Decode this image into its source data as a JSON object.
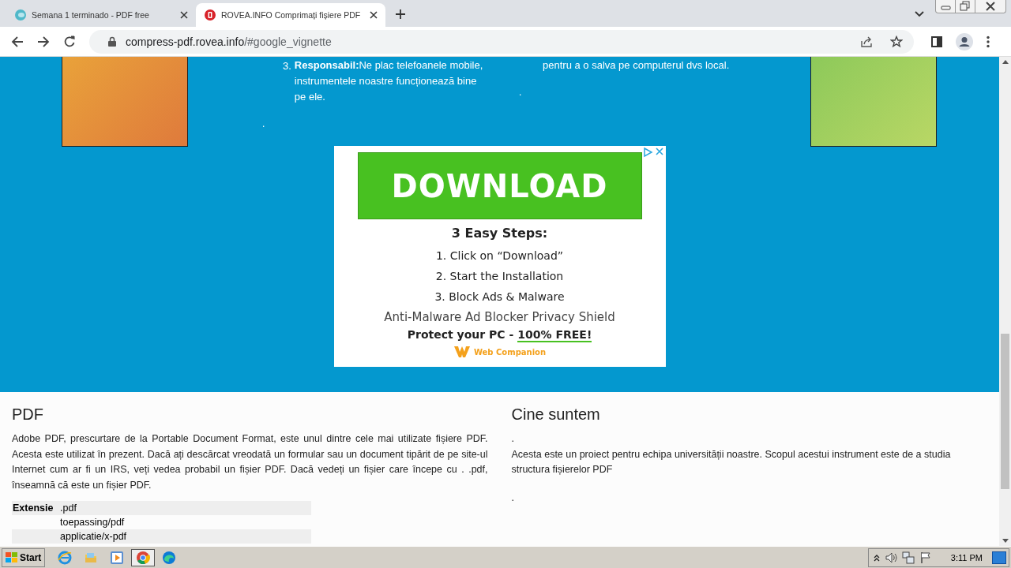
{
  "browser": {
    "tabs": [
      {
        "title": "Semana 1 terminado - PDF free",
        "selected": false
      },
      {
        "title": "ROVEA.INFO Comprimați fișiere PDF",
        "selected": true
      }
    ],
    "url_host": "compress-pdf.rovea.info",
    "url_path": "/#google_vignette"
  },
  "features": {
    "items": [
      {
        "number": "3.",
        "term": "Responsabil:",
        "text": "Ne plac telefoanele mobile, instrumentele noastre funcționează bine pe ele."
      }
    ],
    "dot_left": ".",
    "note": "pentru a o salva pe computerul dvs local.",
    "dot_right": "."
  },
  "ad": {
    "button": "DOWNLOAD",
    "heading": "3 Easy Steps:",
    "steps": [
      "1. Click on “Download”",
      "2. Start the Installation",
      "3. Block Ads & Malware"
    ],
    "tagline": "Anti-Malware Ad Blocker Privacy Shield",
    "offer": "Protect your PC -",
    "offer_highlight": "100% FREE!",
    "brand": "Web Companion"
  },
  "pdf_section": {
    "title": "PDF",
    "text": "Adobe PDF, prescurtare de la Portable Document Format, este unul dintre cele mai utilizate fișiere PDF. Acesta este utilizat în prezent. Dacă ați descărcat vreodată un formular sau un document tipărit de pe site-ul Internet cum ar fi un IRS, veți vedea probabil un fișier PDF. Dacă vedeți un fișier care începe cu . .pdf, înseamnă că este un fișier PDF.",
    "table": [
      {
        "label": "Extensie",
        "value": ".pdf"
      },
      {
        "value": "toepassing/pdf"
      },
      {
        "value": "applicatie/x-pdf"
      }
    ]
  },
  "about": {
    "title": "Cine suntem",
    "paragraphs": [
      ".",
      "Acesta este un proiect pentru echipa universității noastre. Scopul acestui instrument este de a studia structura fișierelor PDF",
      "."
    ]
  },
  "taskbar": {
    "start": "Start",
    "apps": [
      {
        "kind": "ie",
        "selected": false
      },
      {
        "kind": "folder",
        "selected": false
      },
      {
        "kind": "media",
        "selected": false
      },
      {
        "kind": "chrome",
        "selected": true
      },
      {
        "kind": "edge",
        "selected": false
      }
    ],
    "clock": "3:11 PM"
  }
}
